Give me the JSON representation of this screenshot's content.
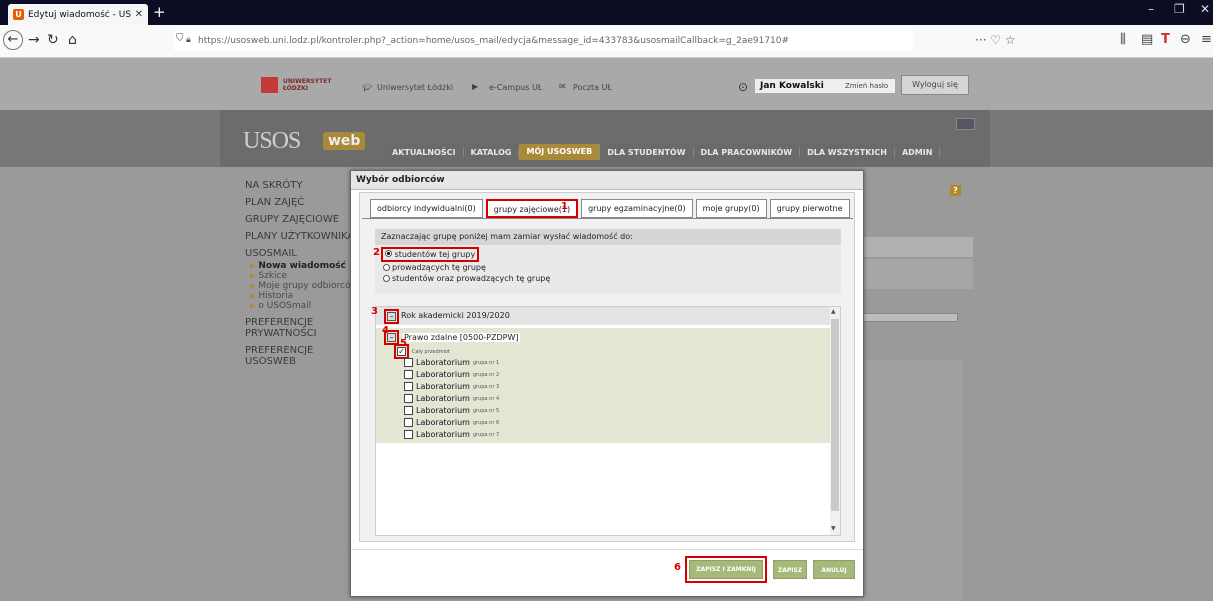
{
  "browser": {
    "tab_title": "Edytuj wiadomość - USOSmail",
    "favicon": "U",
    "url": "https://usosweb.uni.lodz.pl/kontroler.php?_action=home/usos_mail/edycja&message_id=433783&usosmailCallback=g_2ae91710#"
  },
  "header": {
    "ul_logo_line1": "UNIWERSYTET",
    "ul_logo_line2": "ŁÓDZKI",
    "links": [
      "Uniwersytet Łódzki",
      "e-Campus UŁ",
      "Poczta UŁ"
    ],
    "user_name": "Jan Kowalski",
    "change_password": "Zmień hasło",
    "logout": "Wyloguj się"
  },
  "banner": {
    "logo_text": "USOS",
    "logo_badge": "web",
    "menu": [
      "AKTUALNOŚCI",
      "KATALOG",
      "MÓJ USOSWEB",
      "DLA STUDENTÓW",
      "DLA PRACOWNIKÓW",
      "DLA WSZYSTKICH",
      "ADMIN"
    ]
  },
  "sidebar": {
    "na_skroty": "NA SKRÓTY",
    "plan": "PLAN ZAJĘĆ",
    "grupy": "GRUPY ZAJĘCIOWE",
    "plany": "PLANY UŻYTKOWNIKA",
    "usosmail": "USOSMAIL",
    "sub": [
      "Nowa wiadomość",
      "Szkice",
      "Moje grupy odbiorców",
      "Historia",
      "o USOSmail"
    ],
    "pref_priv": "PREFERENCJE PRYWATNOŚCI",
    "pref_usos": "PREFERENCJE USOSWEB"
  },
  "modal": {
    "title": "Wybór odbiorców",
    "tabs": [
      "odbiorcy indywidualni(0)",
      "grupy zajęciowe(1)",
      "grupy egzaminacyjne(0)",
      "moje grupy(0)",
      "grupy pierwotne"
    ],
    "radio_header": "Zaznaczając grupę poniżej mam zamiar wysłać wiadomość do:",
    "radios": [
      "studentów tej grupy",
      "prowadzących tę grupę",
      "studentów oraz prowadzących tę grupę"
    ],
    "year": "Rok akademicki 2019/2020",
    "course": "Prawo zdalne",
    "course_code": "[0500-PZDPW]",
    "whole_subject": "Cały przedmiot",
    "lab_name": "Laboratorium",
    "lab_groups": [
      "grupa nr 1",
      "grupa nr 2",
      "grupa nr 3",
      "grupa nr 4",
      "grupa nr 5",
      "grupa nr 6",
      "grupa nr 7"
    ],
    "btn_save_close": "ZAPISZ I ZAMKNIJ",
    "btn_save": "ZAPISZ",
    "btn_cancel": "ANULUJ"
  },
  "annotations": {
    "n1": "1",
    "n2": "2",
    "n3": "3",
    "n4": "4",
    "n5": "5",
    "n6": "6"
  },
  "colors": {
    "highlight": "#d40000",
    "accent": "#a98a3a",
    "button": "#a6b97a"
  }
}
